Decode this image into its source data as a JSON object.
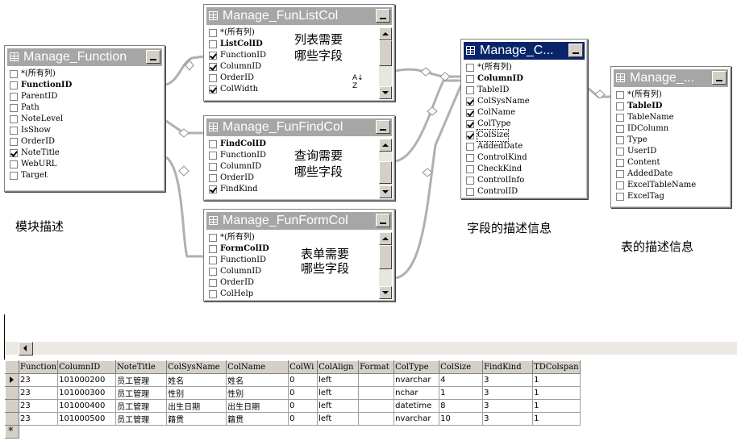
{
  "tables": {
    "manage_function": {
      "title": "Manage_Function",
      "fields": [
        {
          "name": "*(所有列)",
          "checked": false,
          "bold": false
        },
        {
          "name": "FunctionID",
          "checked": false,
          "bold": true
        },
        {
          "name": "ParentID",
          "checked": false,
          "bold": false
        },
        {
          "name": "Path",
          "checked": false,
          "bold": false
        },
        {
          "name": "NoteLevel",
          "checked": false,
          "bold": false
        },
        {
          "name": "IsShow",
          "checked": false,
          "bold": false
        },
        {
          "name": "OrderID",
          "checked": false,
          "bold": false
        },
        {
          "name": "NoteTitle",
          "checked": true,
          "bold": false
        },
        {
          "name": "WebURL",
          "checked": false,
          "bold": false
        },
        {
          "name": "Target",
          "checked": false,
          "bold": false
        }
      ]
    },
    "manage_funlistcol": {
      "title": "Manage_FunListCol",
      "fields": [
        {
          "name": "*(所有列)",
          "checked": false,
          "bold": false
        },
        {
          "name": "ListColID",
          "checked": false,
          "bold": true
        },
        {
          "name": "FunctionID",
          "checked": true,
          "bold": false
        },
        {
          "name": "ColumnID",
          "checked": true,
          "bold": false
        },
        {
          "name": "OrderID",
          "checked": false,
          "bold": false
        },
        {
          "name": "ColWidth",
          "checked": true,
          "bold": false
        }
      ]
    },
    "manage_funfindcol": {
      "title": "Manage_FunFindCol",
      "fields": [
        {
          "name": "FindColID",
          "checked": false,
          "bold": true
        },
        {
          "name": "FunctionID",
          "checked": false,
          "bold": false
        },
        {
          "name": "ColumnID",
          "checked": false,
          "bold": false
        },
        {
          "name": "OrderID",
          "checked": false,
          "bold": false
        },
        {
          "name": "FindKind",
          "checked": true,
          "bold": false
        }
      ]
    },
    "manage_funformcol": {
      "title": "Manage_FunFormCol",
      "fields": [
        {
          "name": "*(所有列)",
          "checked": false,
          "bold": false
        },
        {
          "name": "FormColID",
          "checked": false,
          "bold": true
        },
        {
          "name": "FunctionID",
          "checked": false,
          "bold": false
        },
        {
          "name": "ColumnID",
          "checked": false,
          "bold": false
        },
        {
          "name": "OrderID",
          "checked": false,
          "bold": false
        },
        {
          "name": "ColHelp",
          "checked": false,
          "bold": false
        }
      ]
    },
    "manage_columns": {
      "title": "Manage_C...",
      "fields": [
        {
          "name": "*(所有列)",
          "checked": false,
          "bold": false
        },
        {
          "name": "ColumnID",
          "checked": false,
          "bold": true
        },
        {
          "name": "TableID",
          "checked": false,
          "bold": false
        },
        {
          "name": "ColSysName",
          "checked": true,
          "bold": false
        },
        {
          "name": "ColName",
          "checked": true,
          "bold": false
        },
        {
          "name": "ColType",
          "checked": true,
          "bold": false
        },
        {
          "name": "ColSize",
          "checked": true,
          "bold": false,
          "selected": true
        },
        {
          "name": "AddedDate",
          "checked": false,
          "bold": false
        },
        {
          "name": "ControlKind",
          "checked": false,
          "bold": false
        },
        {
          "name": "CheckKind",
          "checked": false,
          "bold": false
        },
        {
          "name": "ControlInfo",
          "checked": false,
          "bold": false
        },
        {
          "name": "ControlID",
          "checked": false,
          "bold": false
        }
      ]
    },
    "manage_tables": {
      "title": "Manage_...",
      "fields": [
        {
          "name": "*(所有列)",
          "checked": false,
          "bold": false
        },
        {
          "name": "TableID",
          "checked": false,
          "bold": true
        },
        {
          "name": "TableName",
          "checked": false,
          "bold": false
        },
        {
          "name": "IDColumn",
          "checked": false,
          "bold": false
        },
        {
          "name": "Type",
          "checked": false,
          "bold": false
        },
        {
          "name": "UserID",
          "checked": false,
          "bold": false
        },
        {
          "name": "Content",
          "checked": false,
          "bold": false
        },
        {
          "name": "AddedDate",
          "checked": false,
          "bold": false
        },
        {
          "name": "ExcelTableName",
          "checked": false,
          "bold": false
        },
        {
          "name": "ExcelTag",
          "checked": false,
          "bold": false
        }
      ]
    }
  },
  "annotations": {
    "list_line1": "列表需要",
    "list_line2": "哪些字段",
    "find_line1": "查询需要",
    "find_line2": "哪些字段",
    "form_line1": "表单需要",
    "form_line2": "哪些字段",
    "module_desc": "模块描述",
    "field_desc": "字段的描述信息",
    "table_desc": "表的描述信息",
    "sort_icon": "A↓Z"
  },
  "grid": {
    "columns": [
      "Function",
      "ColumnID",
      "NoteTitle",
      "ColSysName",
      "ColName",
      "ColWi",
      "ColAlign",
      "Format",
      "ColType",
      "ColSize",
      "FindKind",
      "TDColspan"
    ],
    "rows": [
      [
        "23",
        "101000200",
        "员工管理",
        "姓名",
        "姓名",
        "0",
        "left",
        "",
        "nvarchar",
        "4",
        "3",
        "1"
      ],
      [
        "23",
        "101000300",
        "员工管理",
        "性别",
        "性别",
        "0",
        "left",
        "",
        "nchar",
        "1",
        "3",
        "1"
      ],
      [
        "23",
        "101000400",
        "员工管理",
        "出生日期",
        "出生日期",
        "0",
        "left",
        "",
        "datetime",
        "8",
        "3",
        "1"
      ],
      [
        "23",
        "101000500",
        "员工管理",
        "籍贯",
        "籍贯",
        "0",
        "left",
        "",
        "nvarchar",
        "10",
        "3",
        "1"
      ]
    ],
    "new_row_marker": "*"
  }
}
